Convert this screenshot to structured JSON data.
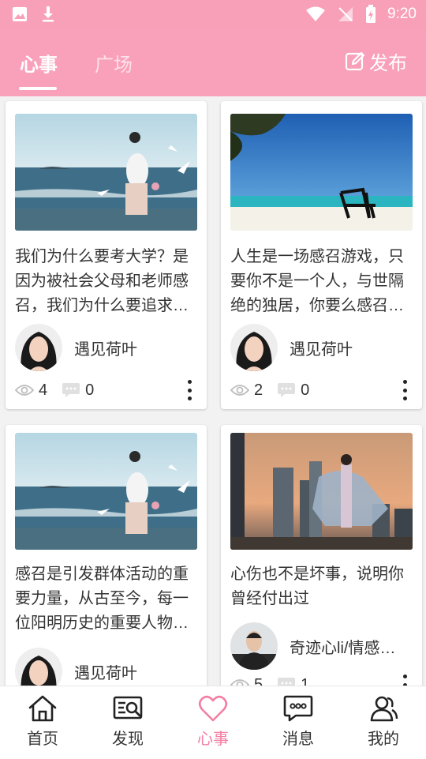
{
  "status_bar": {
    "time": "9:20"
  },
  "header": {
    "tabs": [
      {
        "label": "心事"
      },
      {
        "label": "广场"
      }
    ],
    "publish_label": "发布"
  },
  "feed": [
    {
      "title": "我们为什么要考大学？是因为被社会父母和老师感召，我们为什么要追求知识、财富？",
      "author": "遇见荷叶",
      "views": "4",
      "comments": "0"
    },
    {
      "title": "人生是一场感召游戏，只要你不是一个人，与世隔绝的独居，你要么感召别人，要么被别人感召",
      "author": "遇见荷叶",
      "views": "2",
      "comments": "0"
    },
    {
      "title": "感召是引发群体活动的重要力量，从古至今，每一位阳明历史的重要人物都是感召大师",
      "author": "遇见荷叶",
      "views": "",
      "comments": ""
    },
    {
      "title": "心伤也不是坏事，说明你曾经付出过",
      "author": "奇迹心li/情感咨询",
      "views": "5",
      "comments": "1"
    }
  ],
  "bottom_nav": [
    {
      "label": "首页"
    },
    {
      "label": "发现"
    },
    {
      "label": "心事"
    },
    {
      "label": "消息"
    },
    {
      "label": "我的"
    }
  ],
  "colors": {
    "brand_pink": "#f9a0ba",
    "active_nav": "#f37fa3"
  }
}
